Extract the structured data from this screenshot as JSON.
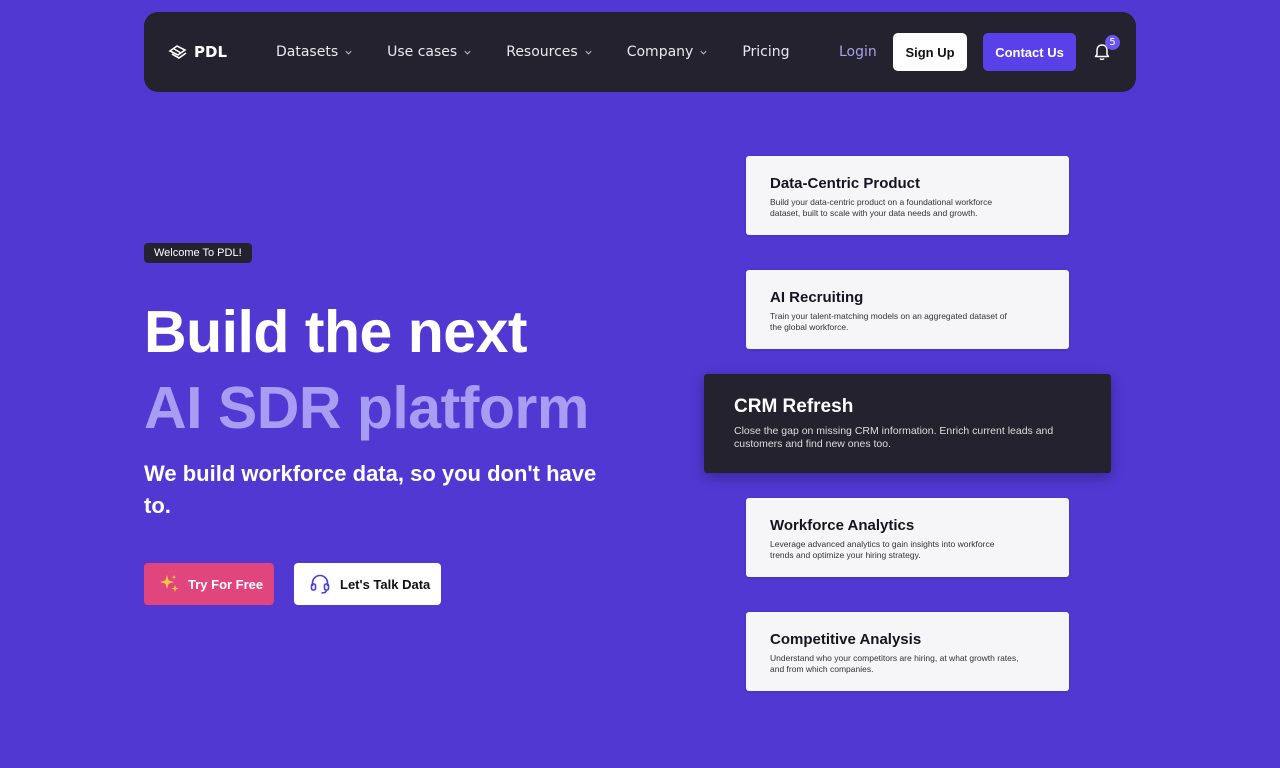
{
  "nav": {
    "logo_text": "PDL",
    "items": [
      {
        "label": "Datasets",
        "has_dropdown": true
      },
      {
        "label": "Use cases",
        "has_dropdown": true
      },
      {
        "label": "Resources",
        "has_dropdown": true
      },
      {
        "label": "Company",
        "has_dropdown": true
      },
      {
        "label": "Pricing",
        "has_dropdown": false
      }
    ],
    "login": "Login",
    "signup": "Sign Up",
    "contact": "Contact Us",
    "notification_count": "5"
  },
  "hero": {
    "welcome_badge": "Welcome To PDL!",
    "headline_line1": "Build the next",
    "headline_line2": "AI SDR platform",
    "subheadline": "We build workforce data, so you don't have to.",
    "try_button": "Try For Free",
    "talk_button": "Let's Talk Data"
  },
  "cards": [
    {
      "title": "Data-Centric Product",
      "desc": "Build your data-centric product on a foundational workforce dataset, built to scale with your data needs and growth.",
      "active": false
    },
    {
      "title": "AI Recruiting",
      "desc": "Train your talent-matching models on an aggregated dataset of the global workforce.",
      "active": false
    },
    {
      "title": "CRM Refresh",
      "desc": "Close the gap on missing CRM information. Enrich current leads and customers and find new ones too.",
      "active": true
    },
    {
      "title": "Workforce Analytics",
      "desc": "Leverage advanced analytics to gain insights into workforce trends and optimize your hiring strategy.",
      "active": false
    },
    {
      "title": "Competitive Analysis",
      "desc": "Understand who your competitors are hiring, at what growth rates, and from which companies.",
      "active": false
    }
  ],
  "colors": {
    "background": "#5138d3",
    "nav_bg": "#24222e",
    "accent": "#5a40e8",
    "headline_accent": "#a89cf3",
    "try_button": "#e0457e"
  },
  "icons": [
    "pdl-logo-icon",
    "chevron-down-icon",
    "bell-icon",
    "sparkles-icon",
    "headset-icon"
  ]
}
